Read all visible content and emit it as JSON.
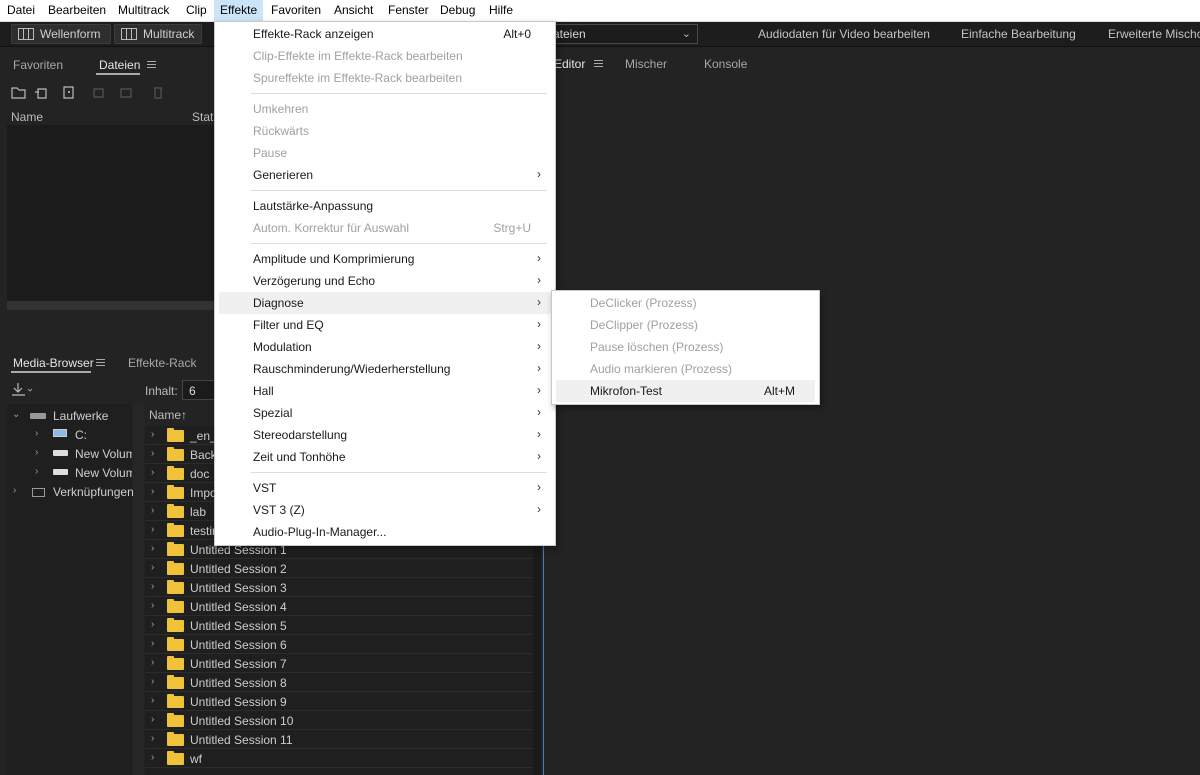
{
  "menubar": [
    "Datei",
    "Bearbeiten",
    "Multitrack",
    "Clip",
    "Effekte",
    "Favoriten",
    "Ansicht",
    "Fenster",
    "Debug",
    "Hilfe"
  ],
  "toolbar": {
    "waveform_label": "Wellenform",
    "multitrack_label": "Multitrack",
    "workspace_value": "ateien",
    "workspace_links": [
      "Audiodaten für Video bearbeiten",
      "Einfache Bearbeitung",
      "Erweiterte Mischop"
    ]
  },
  "files_panel": {
    "tab_favorites": "Favoriten",
    "tab_files": "Dateien",
    "col_name": "Name",
    "col_status": "Statu"
  },
  "media_panel": {
    "tab_media": "Media-Browser",
    "tab_effects": "Effekte-Rack",
    "content_label": "Inhalt:",
    "content_value": "6",
    "col_name": "Name",
    "sort_arrow": "↑",
    "tree": {
      "drives": "Laufwerke",
      "c_drive": "C:",
      "vol1": "New Volume",
      "vol2": "New Volume",
      "shortcuts": "Verknüpfungen"
    },
    "items": [
      "_en_",
      "Back",
      "doc",
      "Impo",
      "lab",
      "testin",
      "Untitled Session 1",
      "Untitled Session 2",
      "Untitled Session 3",
      "Untitled Session 4",
      "Untitled Session 5",
      "Untitled Session 6",
      "Untitled Session 7",
      "Untitled Session 8",
      "Untitled Session 9",
      "Untitled Session 10",
      "Untitled Session 11",
      "wf"
    ]
  },
  "editor_panel": {
    "tab_editor": "Editor",
    "tab_mixer": "Mischer",
    "tab_console": "Konsole"
  },
  "effects_menu": {
    "show_rack": "Effekte-Rack anzeigen",
    "show_rack_sc": "Alt+0",
    "clip_fx": "Clip-Effekte im Effekte-Rack bearbeiten",
    "track_fx": "Spureffekte im Effekte-Rack bearbeiten",
    "invert": "Umkehren",
    "reverse": "Rückwärts",
    "pause": "Pause",
    "generate": "Generieren",
    "volume": "Lautstärke-Anpassung",
    "auto_fix": "Autom. Korrektur für Auswahl",
    "auto_fix_sc": "Strg+U",
    "amplitude": "Amplitude und Komprimierung",
    "delay": "Verzögerung und Echo",
    "diagnose": "Diagnose",
    "filter": "Filter und EQ",
    "modulation": "Modulation",
    "noise": "Rauschminderung/Wiederherstellung",
    "reverb": "Hall",
    "special": "Spezial",
    "stereo": "Stereodarstellung",
    "time_pitch": "Zeit und Tonhöhe",
    "vst": "VST",
    "vst3": "VST 3 (Z)",
    "plugin_manager": "Audio-Plug-In-Manager..."
  },
  "diagnose_submenu": {
    "declicker": "DeClicker (Prozess)",
    "declipper": "DeClipper (Prozess)",
    "delete_pause": "Pause löschen (Prozess)",
    "mark_audio": "Audio markieren (Prozess)",
    "mic_test": "Mikrofon-Test",
    "mic_test_sc": "Alt+M"
  }
}
